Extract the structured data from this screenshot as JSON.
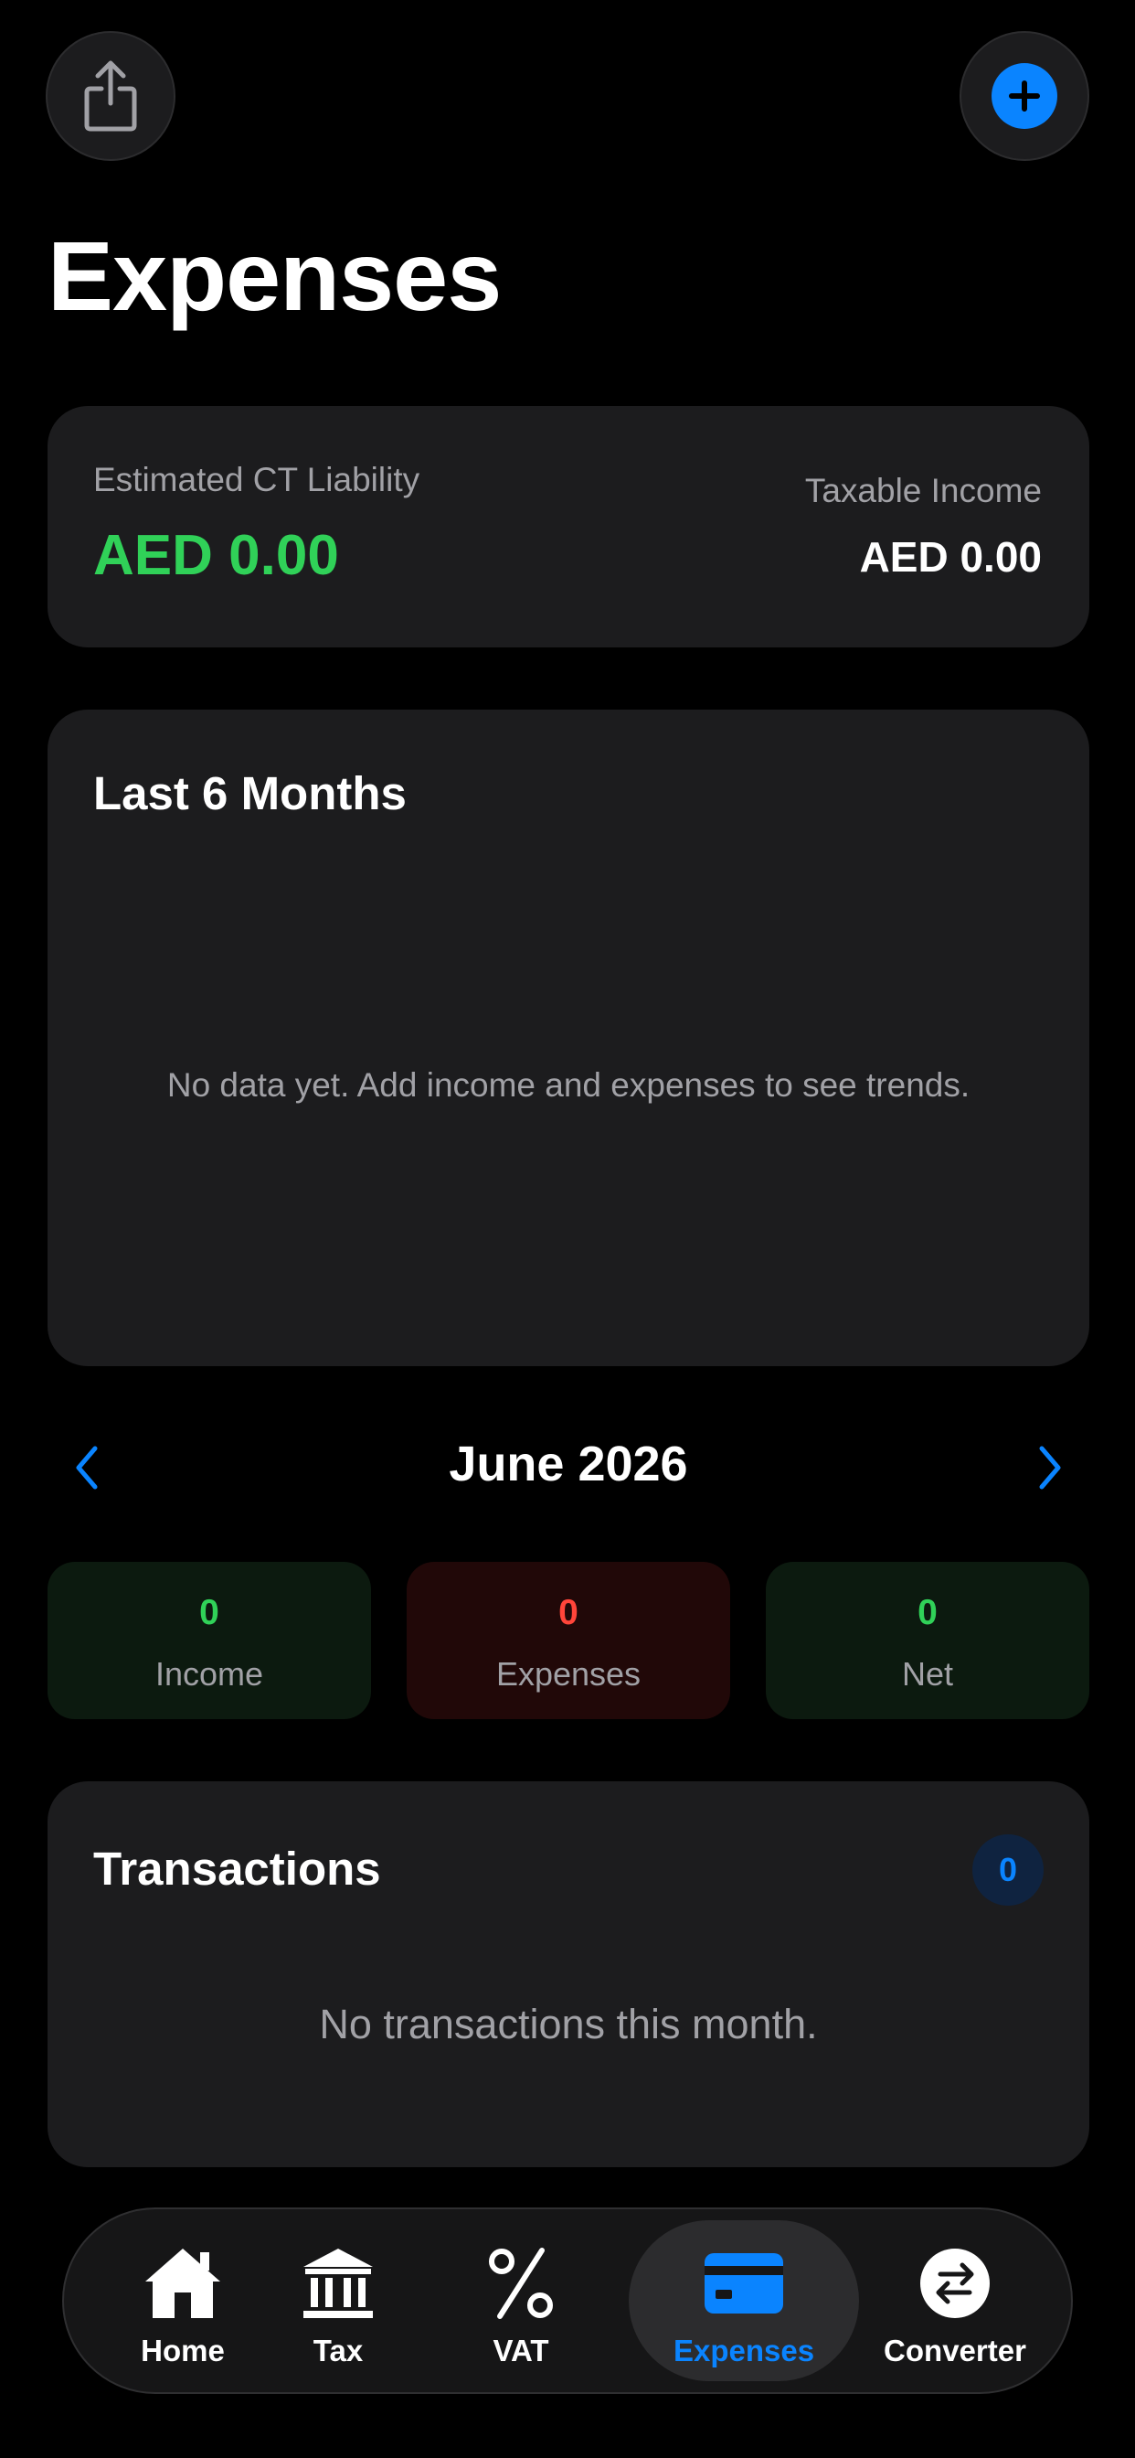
{
  "header": {
    "title": "Expenses"
  },
  "summary": {
    "ct_label": "Estimated CT Liability",
    "ct_value": "AED 0.00",
    "taxable_label": "Taxable Income",
    "taxable_value": "AED 0.00"
  },
  "chart": {
    "title": "Last 6 Months",
    "empty_text": "No data yet. Add income and expenses to see trends."
  },
  "month_nav": {
    "label": "June 2026"
  },
  "stats": {
    "income": {
      "value": "0",
      "label": "Income"
    },
    "expenses": {
      "value": "0",
      "label": "Expenses"
    },
    "net": {
      "value": "0",
      "label": "Net"
    }
  },
  "transactions": {
    "title": "Transactions",
    "count": "0",
    "empty_text": "No transactions this month."
  },
  "tabbar": {
    "items": [
      {
        "label": "Home",
        "icon": "house-icon"
      },
      {
        "label": "Tax",
        "icon": "bank-icon"
      },
      {
        "label": "VAT",
        "icon": "percent-icon"
      },
      {
        "label": "Expenses",
        "icon": "credit-card-icon",
        "active": true
      },
      {
        "label": "Converter",
        "icon": "arrows-exchange-icon"
      }
    ]
  },
  "colors": {
    "accent": "#0a84ff",
    "positive": "#30d158",
    "negative": "#ff453a",
    "background": "#000000",
    "card": "#1c1c1e"
  }
}
